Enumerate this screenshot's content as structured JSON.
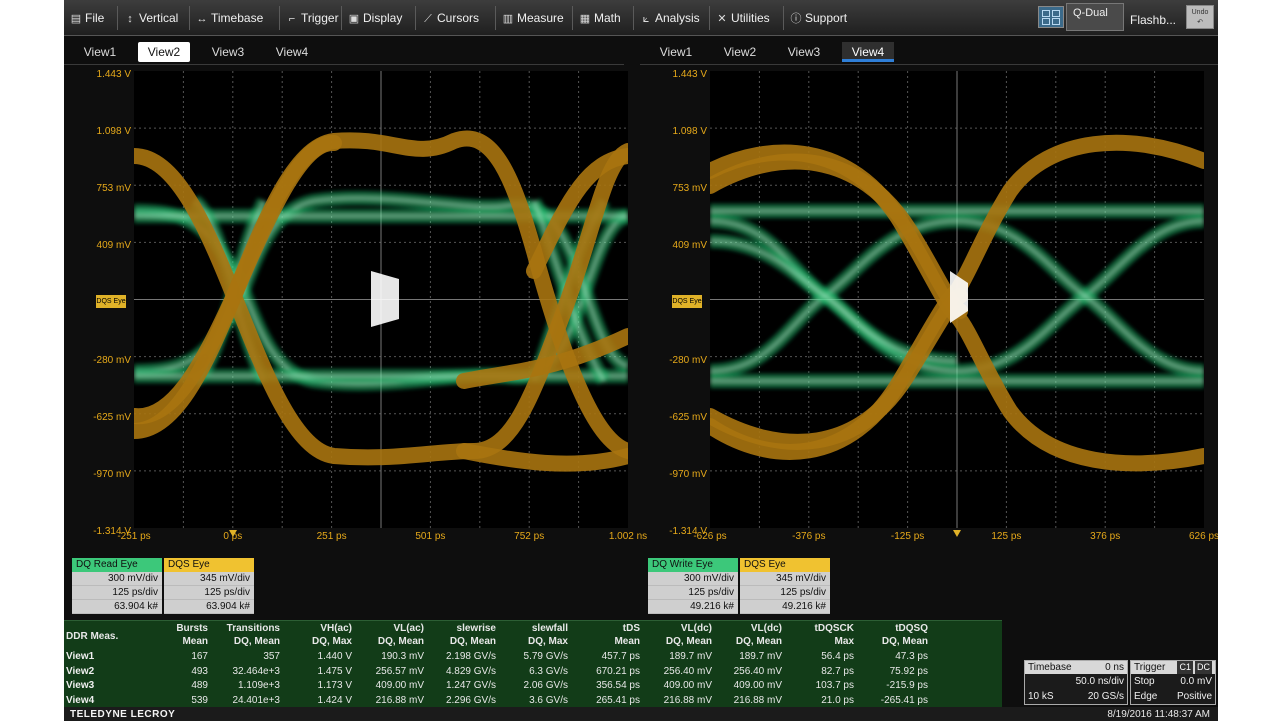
{
  "menu": {
    "items": [
      {
        "label": "File",
        "icon": "file-icon",
        "glyph": "▤"
      },
      {
        "label": "Vertical",
        "icon": "vertical-arrows-icon",
        "glyph": "↕"
      },
      {
        "label": "Timebase",
        "icon": "horizontal-arrows-icon",
        "glyph": "↔"
      },
      {
        "label": "Trigger",
        "icon": "trigger-icon",
        "glyph": "⌐"
      },
      {
        "label": "Display",
        "icon": "display-icon",
        "glyph": "▣"
      },
      {
        "label": "Cursors",
        "icon": "cursor-icon",
        "glyph": "⟋"
      },
      {
        "label": "Measure",
        "icon": "measure-icon",
        "glyph": "▥"
      },
      {
        "label": "Math",
        "icon": "math-icon",
        "glyph": "▦"
      },
      {
        "label": "Analysis",
        "icon": "analysis-icon",
        "glyph": "⟀"
      },
      {
        "label": "Utilities",
        "icon": "utilities-icon",
        "glyph": "✕"
      },
      {
        "label": "Support",
        "icon": "support-icon",
        "glyph": "ⓘ"
      }
    ],
    "qdual_label": "Q-Dual",
    "flash_label": "Flashb...",
    "undo_label": "Undo"
  },
  "left_tabs": [
    "View1",
    "View2",
    "View3",
    "View4"
  ],
  "right_tabs": [
    "View1",
    "View2",
    "View3",
    "View4"
  ],
  "left_grid": {
    "y_labels": [
      "1.443 V",
      "1.098 V",
      "753 mV",
      "409 mV",
      "",
      "-280 mV",
      "-625 mV",
      "-970 mV",
      "-1.314 V"
    ],
    "x_labels": [
      "-251 ps",
      "0 ps",
      "251 ps",
      "501 ps",
      "752 ps",
      "1.002 ns"
    ],
    "ref_label": "DQS Eye"
  },
  "right_grid": {
    "y_labels": [
      "1.443 V",
      "1.098 V",
      "753 mV",
      "409 mV",
      "",
      "-280 mV",
      "-625 mV",
      "-970 mV",
      "-1.314 V"
    ],
    "x_labels": [
      "-626 ps",
      "-376 ps",
      "-125 ps",
      "125 ps",
      "376 ps",
      "626 ps"
    ],
    "ref_label": "DQS Eye"
  },
  "colors": {
    "dq": "#1fcf7a",
    "dqs": "#a87410",
    "axis_label": "#e6a91a",
    "dq_desc": "#3cc87a",
    "dqs_desc": "#f0c230",
    "meas_bg": "#123c18"
  },
  "left_desc": [
    {
      "title": "DQ Read Eye",
      "lines": [
        "300 mV/div",
        "125 ps/div",
        "63.904 k#"
      ],
      "kind": "dq"
    },
    {
      "title": "DQS Eye",
      "lines": [
        "345 mV/div",
        "125 ps/div",
        "63.904 k#"
      ],
      "kind": "dqs"
    }
  ],
  "right_desc": [
    {
      "title": "DQ Write Eye",
      "lines": [
        "300 mV/div",
        "125 ps/div",
        "49.216 k#"
      ],
      "kind": "dq"
    },
    {
      "title": "DQS Eye",
      "lines": [
        "345 mV/div",
        "125 ps/div",
        "49.216 k#"
      ],
      "kind": "dqs"
    }
  ],
  "measurements": {
    "title": "DDR Meas.",
    "headers": [
      [
        "Bursts",
        "Mean"
      ],
      [
        "Transitions",
        "DQ, Mean"
      ],
      [
        "VH(ac)",
        "DQ, Max"
      ],
      [
        "VL(ac)",
        "DQ, Mean"
      ],
      [
        "slewrise",
        "DQ, Mean"
      ],
      [
        "slewfall",
        "DQ, Max"
      ],
      [
        "tDS",
        "Mean"
      ],
      [
        "VL(dc)",
        "DQ, Mean"
      ],
      [
        "VL(dc)",
        "DQ, Mean"
      ],
      [
        "tDQSCK",
        "Max"
      ],
      [
        "tDQSQ",
        "DQ, Mean"
      ]
    ],
    "rows": [
      {
        "label": "View1",
        "values": [
          "167",
          "357",
          "1.440 V",
          "190.3 mV",
          "2.198 GV/s",
          "5.79 GV/s",
          "457.7 ps",
          "189.7 mV",
          "189.7 mV",
          "56.4 ps",
          "47.3 ps"
        ]
      },
      {
        "label": "View2",
        "values": [
          "493",
          "32.464e+3",
          "1.475 V",
          "256.57 mV",
          "4.829 GV/s",
          "6.3 GV/s",
          "670.21 ps",
          "256.40 mV",
          "256.40 mV",
          "82.7 ps",
          "75.92 ps"
        ]
      },
      {
        "label": "View3",
        "values": [
          "489",
          "1.109e+3",
          "1.173 V",
          "409.00 mV",
          "1.247 GV/s",
          "2.06 GV/s",
          "356.54 ps",
          "409.00 mV",
          "409.00 mV",
          "103.7 ps",
          "-215.9 ps"
        ]
      },
      {
        "label": "View4",
        "values": [
          "539",
          "24.401e+3",
          "1.424 V",
          "216.88 mV",
          "2.296 GV/s",
          "3.6 GV/s",
          "265.41 ps",
          "216.88 mV",
          "216.88 mV",
          "21.0 ps",
          "-265.41 ps"
        ]
      }
    ]
  },
  "timebase": {
    "title": "Timebase",
    "offset": "0 ns",
    "div": "50.0 ns/div",
    "samples": "10 kS",
    "rate": "20 GS/s"
  },
  "trigger": {
    "title": "Trigger",
    "badges": [
      "C1",
      "DC"
    ],
    "mode": "Stop",
    "level": "0.0 mV",
    "type": "Edge",
    "slope": "Positive"
  },
  "status": {
    "brand": "TELEDYNE LECROY",
    "datetime": "8/19/2016 11:48:37 AM"
  }
}
